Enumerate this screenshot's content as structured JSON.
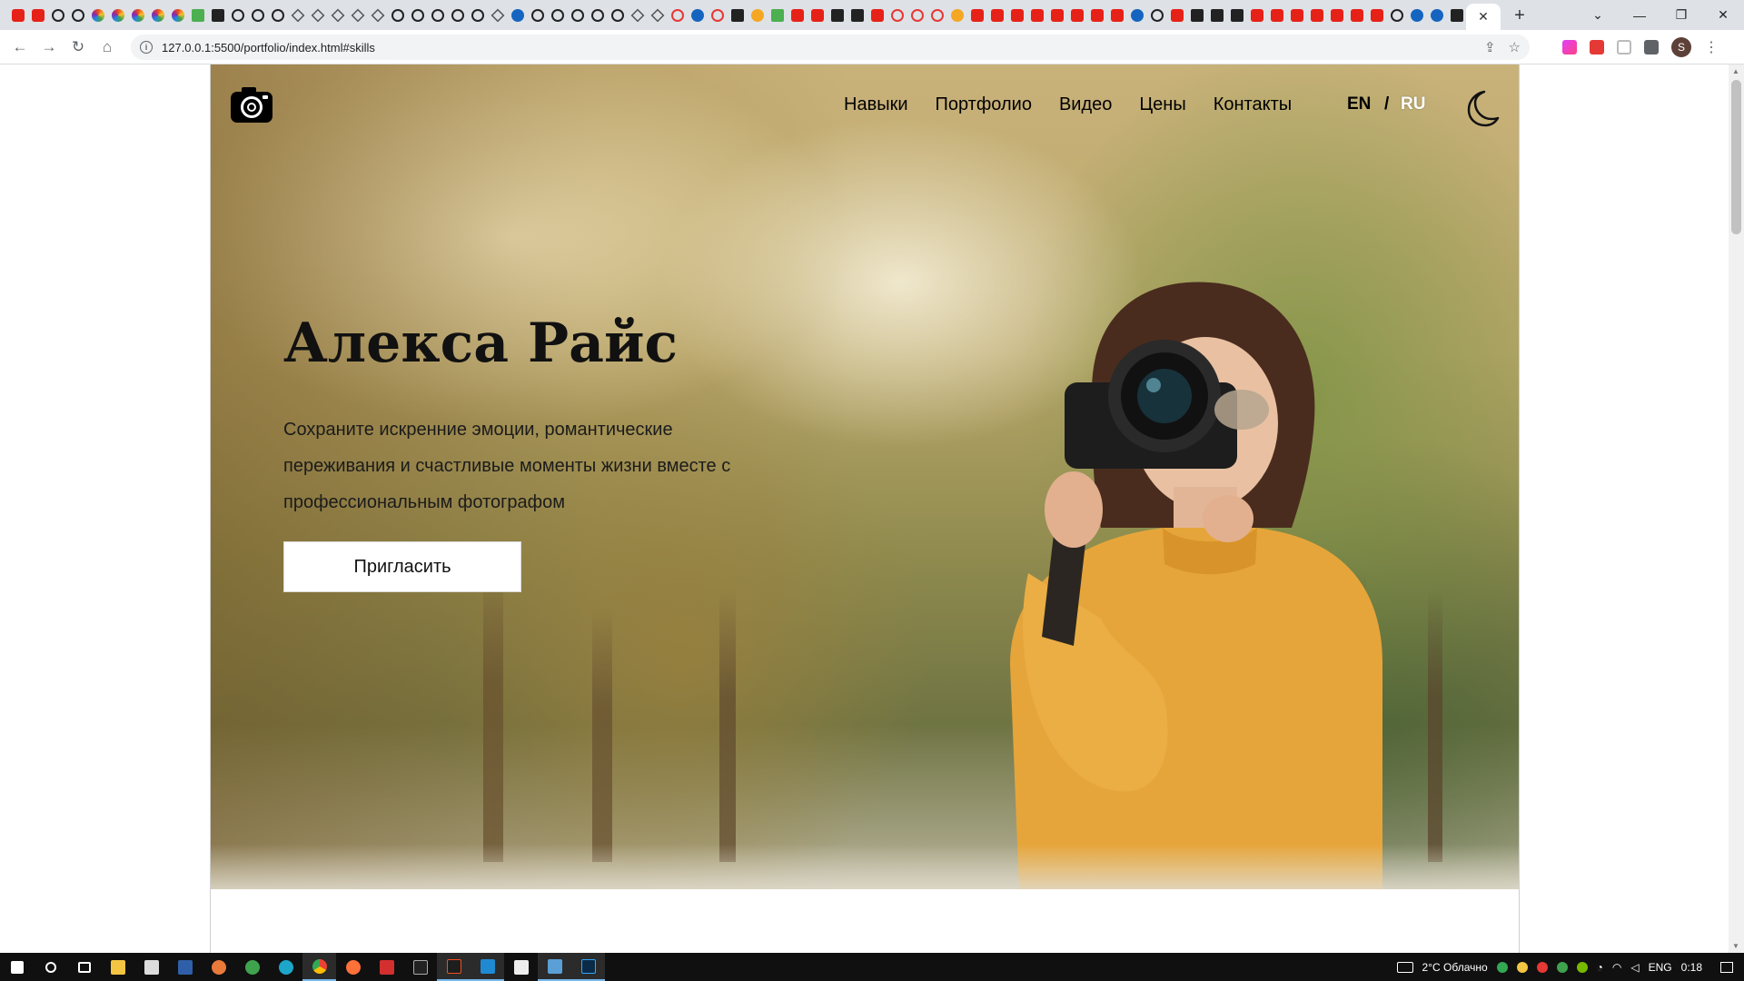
{
  "browser": {
    "url": "127.0.0.1:5500/portfolio/index.html#skills",
    "active_tab_close": "✕",
    "new_tab": "+",
    "avatar_letter": "S",
    "window_controls": [
      "⌄",
      "—",
      "❐",
      "✕"
    ]
  },
  "site": {
    "nav": [
      "Навыки",
      "Портфолио",
      "Видео",
      "Цены",
      "Контакты"
    ],
    "lang_en": "EN",
    "lang_sep": "/",
    "lang_ru": "RU",
    "title": "Алекса Райс",
    "description": "Сохраните искренние эмоции, романтические переживания и счастливые моменты жизни вместе с профессиональным фотографом",
    "cta": "Пригласить"
  },
  "taskbar": {
    "weather": "2°C Облачно",
    "lang": "ENG",
    "time": "0:18"
  },
  "colors": {
    "accent_ru": "#ffffff",
    "nav_text": "#000000",
    "taskbar_bg": "#101010"
  }
}
